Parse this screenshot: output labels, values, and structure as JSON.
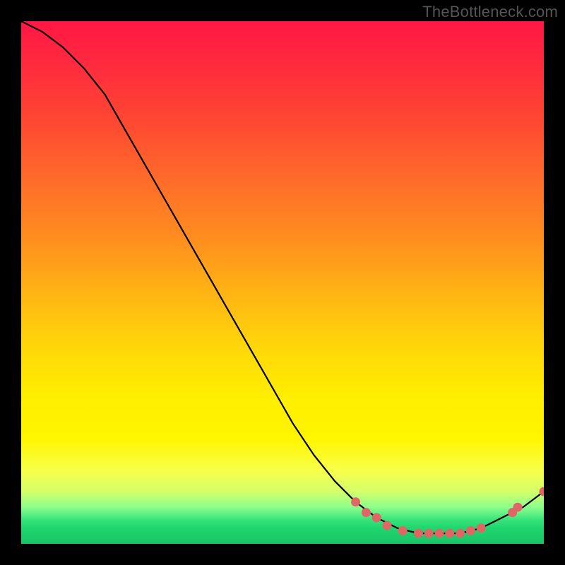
{
  "watermark": "TheBottleneck.com",
  "chart_data": {
    "type": "line",
    "title": "",
    "xlabel": "",
    "ylabel": "",
    "xlim": [
      0,
      100
    ],
    "ylim": [
      0,
      100
    ],
    "series": [
      {
        "name": "curve",
        "x": [
          0,
          4,
          8,
          12,
          16,
          20,
          24,
          28,
          32,
          36,
          40,
          44,
          48,
          52,
          56,
          60,
          64,
          68,
          72,
          76,
          80,
          84,
          88,
          92,
          96,
          100
        ],
        "y": [
          100,
          98,
          95,
          91,
          86,
          79,
          72,
          65,
          58,
          51,
          44,
          37,
          30,
          23,
          17,
          12,
          8,
          5,
          3,
          2,
          2,
          2,
          3,
          5,
          7,
          10
        ]
      }
    ],
    "markers": [
      {
        "x": 64,
        "y": 8
      },
      {
        "x": 66,
        "y": 6
      },
      {
        "x": 68,
        "y": 5
      },
      {
        "x": 70,
        "y": 3.5
      },
      {
        "x": 73,
        "y": 2.5
      },
      {
        "x": 76,
        "y": 2
      },
      {
        "x": 78,
        "y": 2
      },
      {
        "x": 80,
        "y": 2
      },
      {
        "x": 82,
        "y": 2
      },
      {
        "x": 84,
        "y": 2
      },
      {
        "x": 86,
        "y": 2.5
      },
      {
        "x": 88,
        "y": 3
      },
      {
        "x": 94,
        "y": 6
      },
      {
        "x": 95,
        "y": 7
      },
      {
        "x": 100,
        "y": 10
      }
    ],
    "marker_color": "#e06666",
    "line_color": "#000000"
  }
}
